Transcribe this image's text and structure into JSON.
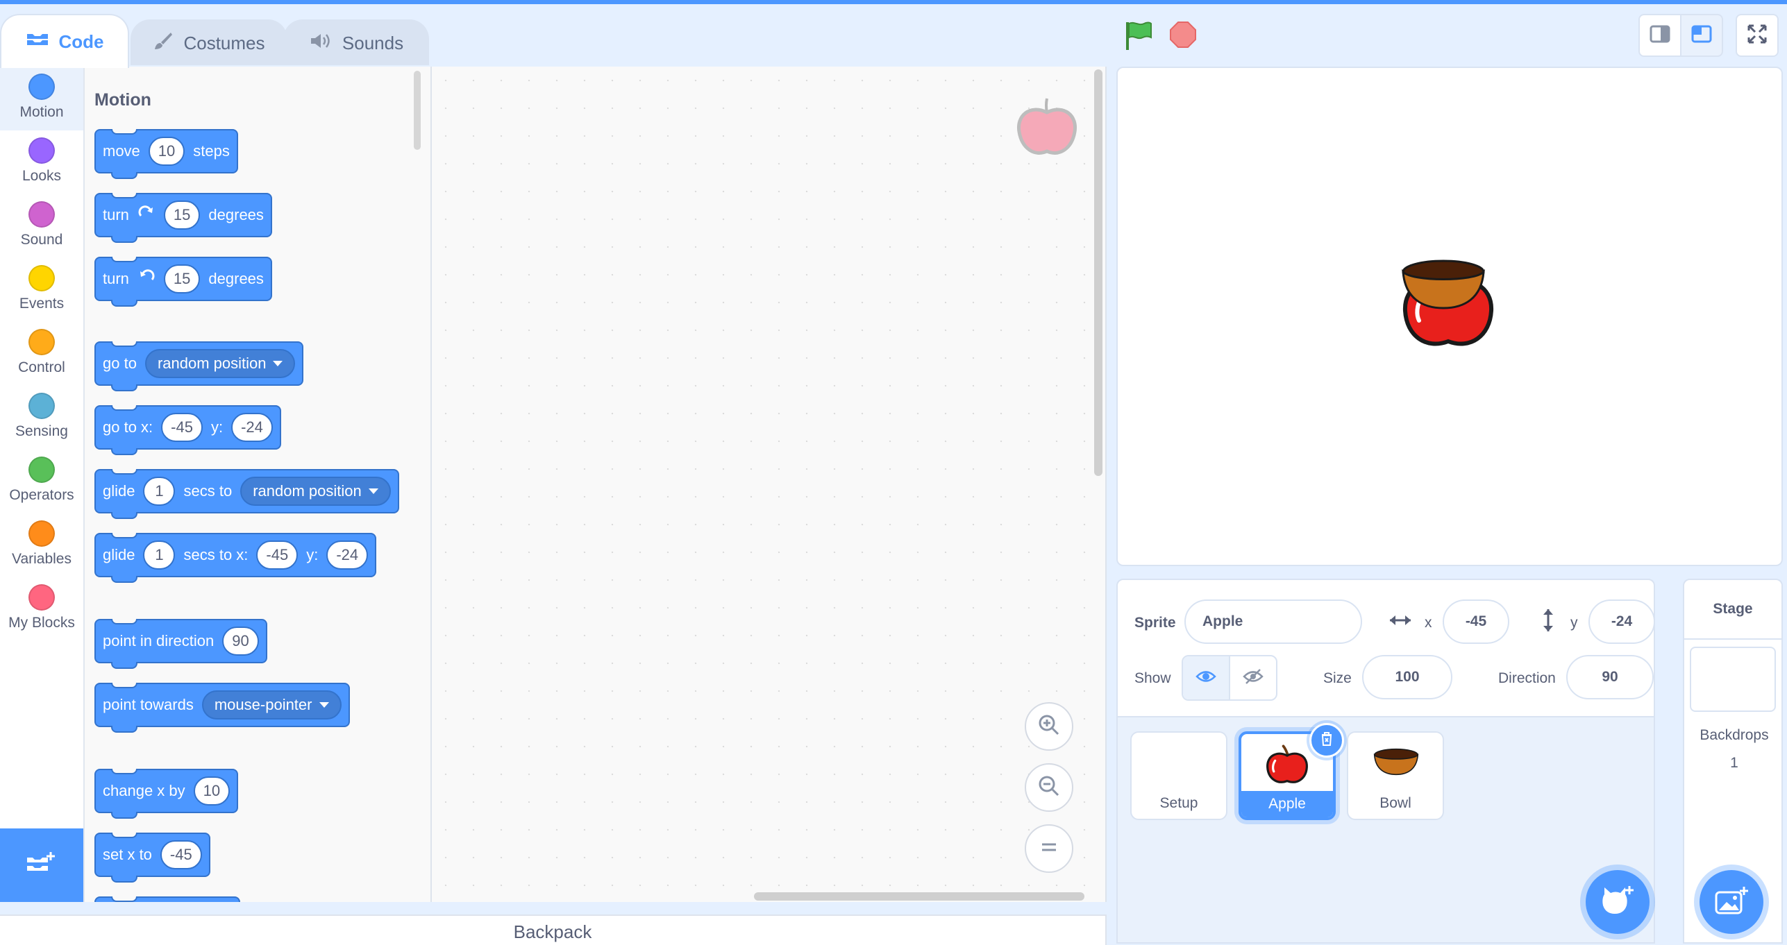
{
  "tabs": {
    "code": "Code",
    "costumes": "Costumes",
    "sounds": "Sounds"
  },
  "categories": [
    {
      "label": "Motion",
      "color": "#4c97ff"
    },
    {
      "label": "Looks",
      "color": "#9966ff"
    },
    {
      "label": "Sound",
      "color": "#cf63cf"
    },
    {
      "label": "Events",
      "color": "#ffd500"
    },
    {
      "label": "Control",
      "color": "#ffab19"
    },
    {
      "label": "Sensing",
      "color": "#5cb1d6"
    },
    {
      "label": "Operators",
      "color": "#59c059"
    },
    {
      "label": "Variables",
      "color": "#ff8c1a"
    },
    {
      "label": "My Blocks",
      "color": "#ff6680"
    }
  ],
  "palette": {
    "title": "Motion",
    "blocks": {
      "move": {
        "t1": "move",
        "v1": "10",
        "t2": "steps"
      },
      "turn_right": {
        "t1": "turn",
        "v1": "15",
        "t2": "degrees"
      },
      "turn_left": {
        "t1": "turn",
        "v1": "15",
        "t2": "degrees"
      },
      "goto": {
        "t1": "go to",
        "d1": "random position"
      },
      "gotoxy": {
        "t1": "go to x:",
        "v1": "-45",
        "t2": "y:",
        "v2": "-24"
      },
      "glide_to": {
        "t1": "glide",
        "v1": "1",
        "t2": "secs to",
        "d1": "random position"
      },
      "glide_xy": {
        "t1": "glide",
        "v1": "1",
        "t2": "secs to x:",
        "v2": "-45",
        "t3": "y:",
        "v3": "-24"
      },
      "point_dir": {
        "t1": "point in direction",
        "v1": "90"
      },
      "point_towards": {
        "t1": "point towards",
        "d1": "mouse-pointer"
      },
      "change_x": {
        "t1": "change x by",
        "v1": "10"
      },
      "set_x": {
        "t1": "set x to",
        "v1": "-45"
      }
    }
  },
  "backpack": "Backpack",
  "sprite_info": {
    "sprite_label": "Sprite",
    "sprite_name": "Apple",
    "x_label": "x",
    "x": "-45",
    "y_label": "y",
    "y": "-24",
    "show_label": "Show",
    "size_label": "Size",
    "size": "100",
    "direction_label": "Direction",
    "direction": "90"
  },
  "sprites": [
    {
      "name": "Setup"
    },
    {
      "name": "Apple"
    },
    {
      "name": "Bowl"
    }
  ],
  "stage_panel": {
    "title": "Stage",
    "backdrops_label": "Backdrops",
    "backdrops_count": "1"
  },
  "colors": {
    "accent": "#4c97ff",
    "motion_block": "#4c97ff",
    "apple_red": "#e8201c",
    "bowl_brown": "#c8731c"
  }
}
